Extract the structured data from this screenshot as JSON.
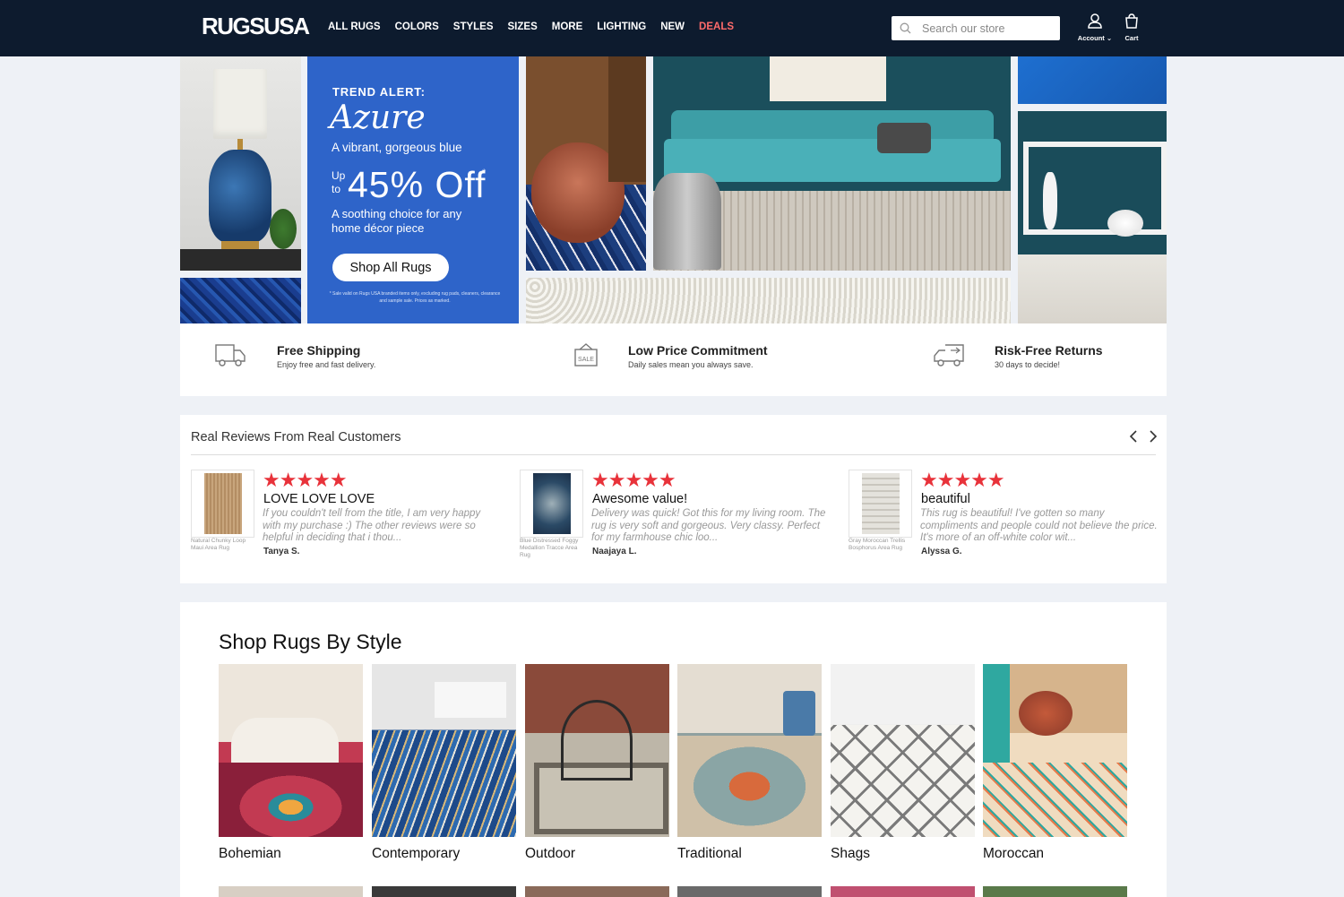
{
  "header": {
    "logo": "RUGSUSA",
    "nav": [
      "ALL RUGS",
      "COLORS",
      "STYLES",
      "SIZES",
      "MORE",
      "LIGHTING",
      "NEW",
      "DEALS"
    ],
    "search_placeholder": "Search our store",
    "account_label": "Account",
    "cart_label": "Cart"
  },
  "hero": {
    "kicker": "TREND ALERT:",
    "title": "Azure",
    "tagline": "A vibrant, gorgeous blue",
    "up_to": "Up to",
    "discount": "45% Off",
    "asterisk": "*",
    "description": "A soothing choice for any home décor piece",
    "cta": "Shop All Rugs",
    "fine_print": "* Sale valid on Rugs USA branded items only, excluding rug pads, cleaners, clearance and sample sale. Prices as marked."
  },
  "features": [
    {
      "title": "Free Shipping",
      "subtitle": "Enjoy free and fast delivery.",
      "icon": "truck-icon"
    },
    {
      "title": "Low Price Commitment",
      "subtitle": "Daily sales mean you always save.",
      "icon": "sale-tag-icon"
    },
    {
      "title": "Risk-Free Returns",
      "subtitle": "30 days to decide!",
      "icon": "return-truck-icon"
    }
  ],
  "reviews": {
    "title": "Real Reviews From Real Customers",
    "items": [
      {
        "product": "Natural Chunky Loop Maui Area Rug",
        "stars": "★★★★★",
        "headline": "LOVE LOVE LOVE",
        "body": "If you couldn't tell from the title, I am very happy with my purchase :) The other reviews were so helpful in deciding that i thou...",
        "author": "Tanya S."
      },
      {
        "product": "Blue Distressed Foggy Medallion Tracce Area Rug",
        "stars": "★★★★★",
        "headline": "Awesome value!",
        "body": "Delivery was quick! Got this for my living room. The rug is very soft and gorgeous. Very classy. Perfect for my farmhouse chic loo...",
        "author": "Naajaya L."
      },
      {
        "product": "Gray Moroccan Trellis Bosphorus Area Rug",
        "stars": "★★★★★",
        "headline": "beautiful",
        "body": "This rug is beautiful! I've gotten so many compliments and people could not believe the price. It's more of an off-white color wit...",
        "author": "Alyssa G."
      }
    ]
  },
  "styles": {
    "title": "Shop Rugs By Style",
    "items": [
      "Bohemian",
      "Contemporary",
      "Outdoor",
      "Traditional",
      "Shags",
      "Moroccan"
    ]
  },
  "colors": {
    "header_bg": "#0d1b2e",
    "hero_blue": "#2e64c9",
    "deals": "#ff6b6b",
    "star": "#e8323a"
  }
}
